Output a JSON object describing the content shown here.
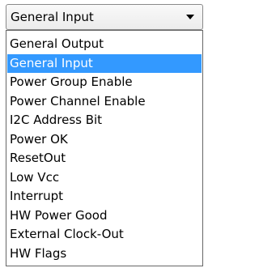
{
  "combobox": {
    "selected_value": "General Input",
    "arrow_icon": "triangle-down-icon"
  },
  "dropdown": {
    "highlighted_index": 1,
    "options": [
      "General Output",
      "General Input",
      "Power Group Enable",
      "Power Channel Enable",
      "I2C Address Bit",
      "Power OK",
      "ResetOut",
      "Low Vcc",
      "Interrupt",
      "HW Power Good",
      "External Clock-Out",
      "HW Flags"
    ]
  },
  "colors": {
    "highlight": "#3399ff",
    "highlight_text": "#ffffff",
    "text": "#000000",
    "border": "#666666"
  }
}
